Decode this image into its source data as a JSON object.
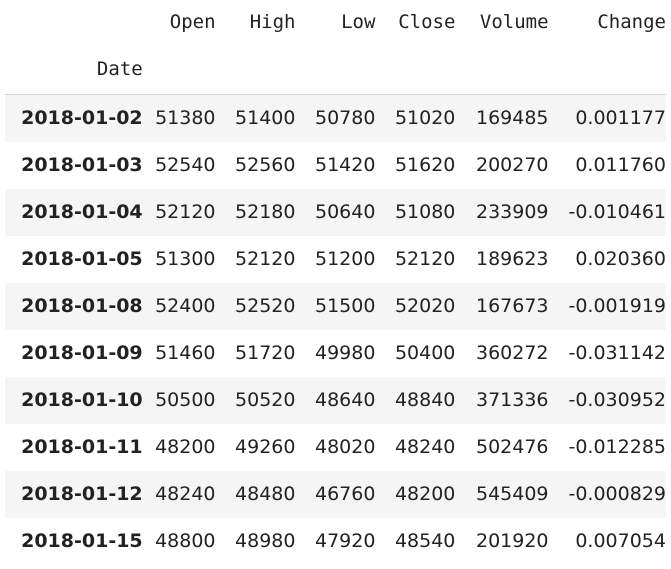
{
  "table": {
    "index_name": "Date",
    "columns": [
      "Open",
      "High",
      "Low",
      "Close",
      "Volume",
      "Change"
    ],
    "rows": [
      {
        "date": "2018-01-02",
        "open": "51380",
        "high": "51400",
        "low": "50780",
        "close": "51020",
        "volume": "169485",
        "change": "0.001177"
      },
      {
        "date": "2018-01-03",
        "open": "52540",
        "high": "52560",
        "low": "51420",
        "close": "51620",
        "volume": "200270",
        "change": "0.011760"
      },
      {
        "date": "2018-01-04",
        "open": "52120",
        "high": "52180",
        "low": "50640",
        "close": "51080",
        "volume": "233909",
        "change": "-0.010461"
      },
      {
        "date": "2018-01-05",
        "open": "51300",
        "high": "52120",
        "low": "51200",
        "close": "52120",
        "volume": "189623",
        "change": "0.020360"
      },
      {
        "date": "2018-01-08",
        "open": "52400",
        "high": "52520",
        "low": "51500",
        "close": "52020",
        "volume": "167673",
        "change": "-0.001919"
      },
      {
        "date": "2018-01-09",
        "open": "51460",
        "high": "51720",
        "low": "49980",
        "close": "50400",
        "volume": "360272",
        "change": "-0.031142"
      },
      {
        "date": "2018-01-10",
        "open": "50500",
        "high": "50520",
        "low": "48640",
        "close": "48840",
        "volume": "371336",
        "change": "-0.030952"
      },
      {
        "date": "2018-01-11",
        "open": "48200",
        "high": "49260",
        "low": "48020",
        "close": "48240",
        "volume": "502476",
        "change": "-0.012285"
      },
      {
        "date": "2018-01-12",
        "open": "48240",
        "high": "48480",
        "low": "46760",
        "close": "48200",
        "volume": "545409",
        "change": "-0.000829"
      },
      {
        "date": "2018-01-15",
        "open": "48800",
        "high": "48980",
        "low": "47920",
        "close": "48540",
        "volume": "201920",
        "change": "0.007054"
      }
    ]
  }
}
